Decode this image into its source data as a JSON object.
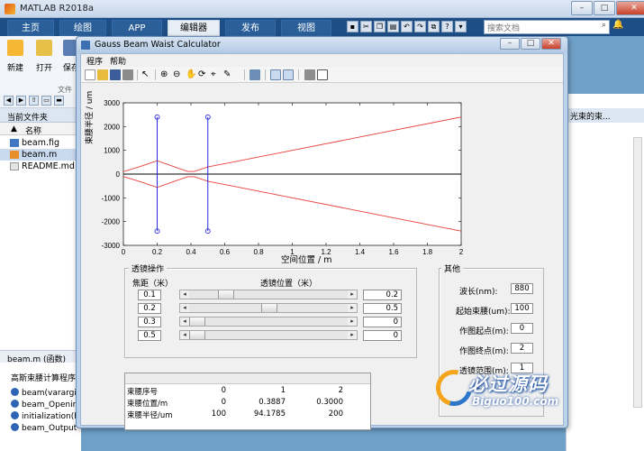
{
  "matlab": {
    "title": "MATLAB R2018a",
    "tabs": [
      "主页",
      "绘图",
      "APP",
      "编辑器",
      "发布",
      "视图"
    ],
    "search_placeholder": "搜索文档",
    "ribbon_buttons": [
      "新建",
      "打开",
      "保存"
    ],
    "ribbon_group": "文件",
    "current_folder_label": "当前文件夹",
    "name_column": "名称",
    "sort_indicator": "▲",
    "files": [
      "beam.fig",
      "beam.m",
      "README.md"
    ],
    "selected_file": "beam.m",
    "detail_header": "beam.m  (函数)",
    "detail_title": "高斯束腰计算程序",
    "functions": [
      "beam(varargi",
      "beam_Openin",
      "initialization(h",
      "beam_Output"
    ],
    "right_header": "光束的束..."
  },
  "figure": {
    "title": "Gauss Beam Waist Calculator",
    "menu": [
      "程序",
      "帮助"
    ],
    "plot": {
      "ylabel": "束腰半径 / um",
      "xlabel": "空间位置 / m"
    },
    "lens_panel": {
      "title": "透镜操作",
      "col_focal": "焦距（米）",
      "col_position": "透镜位置（米）",
      "rows": [
        {
          "focal": "0.1",
          "slider": 0.2,
          "position": "0.2"
        },
        {
          "focal": "0.2",
          "slider": 0.5,
          "position": "0.5"
        },
        {
          "focal": "0.3",
          "slider": 0.0,
          "position": "0"
        },
        {
          "focal": "0.5",
          "slider": 0.0,
          "position": "0"
        }
      ]
    },
    "other_panel": {
      "title": "其他",
      "fields": [
        {
          "label": "波长(nm):",
          "value": "880"
        },
        {
          "label": "起始束腰(um):",
          "value": "100"
        },
        {
          "label": "作图起点(m):",
          "value": "0"
        },
        {
          "label": "作图终点(m):",
          "value": "2"
        },
        {
          "label": "透镜范围(m):",
          "value": "1"
        }
      ],
      "partial_label": "一"
    },
    "table": {
      "rows": [
        {
          "label": "束腰序号",
          "values": [
            "0",
            "1",
            "2"
          ]
        },
        {
          "label": "束腰位置/m",
          "values": [
            "0",
            "0.3887",
            "0.3000"
          ]
        },
        {
          "label": "束腰半径/um",
          "values": [
            "100",
            "94.1785",
            "200"
          ]
        }
      ]
    }
  },
  "watermark": {
    "main": "必过源码",
    "sub": "Biguo100.com"
  },
  "chart_data": {
    "type": "line",
    "title": "",
    "xlabel": "空间位置 / m",
    "ylabel": "束腰半径 / um",
    "xlim": [
      0,
      2
    ],
    "ylim": [
      -3000,
      3000
    ],
    "xticks": [
      0,
      0.2,
      0.4,
      0.6,
      0.8,
      1,
      1.2,
      1.4,
      1.6,
      1.8,
      2
    ],
    "yticks": [
      -3000,
      -2000,
      -1000,
      0,
      1000,
      2000,
      3000
    ],
    "grid": false,
    "series": [
      {
        "color": "#e8403a",
        "x": [
          0,
          0.1,
          0.2,
          0.3,
          0.38,
          0.42,
          0.5,
          1.0,
          1.5,
          2.0
        ],
        "y": [
          100,
          320,
          560,
          310,
          110,
          110,
          300,
          1000,
          1700,
          2400
        ]
      },
      {
        "color": "#e8403a",
        "x": [
          0,
          0.1,
          0.2,
          0.3,
          0.38,
          0.42,
          0.5,
          1.0,
          1.5,
          2.0
        ],
        "y": [
          -100,
          -320,
          -560,
          -310,
          -110,
          -110,
          -300,
          -1000,
          -1700,
          -2400
        ]
      },
      {
        "color": "#000000",
        "x": [
          0,
          2
        ],
        "y": [
          0,
          0
        ]
      }
    ],
    "lenses": [
      {
        "x": 0.2,
        "ymin": -2400,
        "ymax": 2400,
        "color": "#2b2bdc"
      },
      {
        "x": 0.5,
        "ymin": -2400,
        "ymax": 2400,
        "color": "#2b2bdc"
      }
    ]
  }
}
